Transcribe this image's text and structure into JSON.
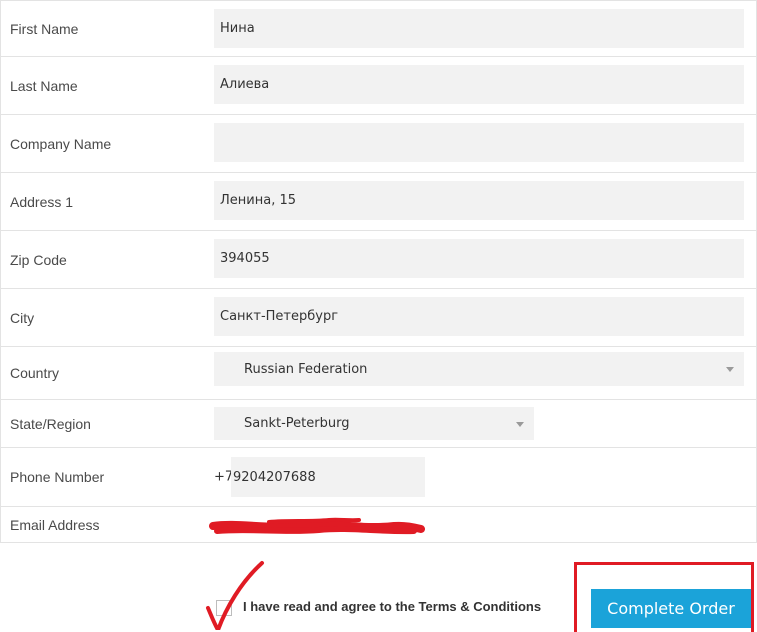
{
  "form": {
    "first_name": {
      "label": "First Name",
      "value": "Нина"
    },
    "last_name": {
      "label": "Last Name",
      "value": "Алиева"
    },
    "company_name": {
      "label": "Company Name",
      "value": ""
    },
    "address1": {
      "label": "Address 1",
      "value": "Ленина, 15"
    },
    "zip_code": {
      "label": "Zip Code",
      "value": "394055"
    },
    "city": {
      "label": "City",
      "value": "Санкт-Петербург"
    },
    "country": {
      "label": "Country",
      "value": "Russian Federation"
    },
    "state": {
      "label": "State/Region",
      "value": "Sankt-Peterburg"
    },
    "phone": {
      "label": "Phone Number",
      "prefix": "+7",
      "value": "9204207688"
    },
    "email": {
      "label": "Email Address"
    }
  },
  "terms": {
    "text": "I have read and agree to the Terms & Conditions"
  },
  "buttons": {
    "complete_order": "Complete Order"
  },
  "colors": {
    "accent": "#1ba3d9",
    "annotation_red": "#e01b24",
    "field_bg": "#f2f2f2"
  }
}
